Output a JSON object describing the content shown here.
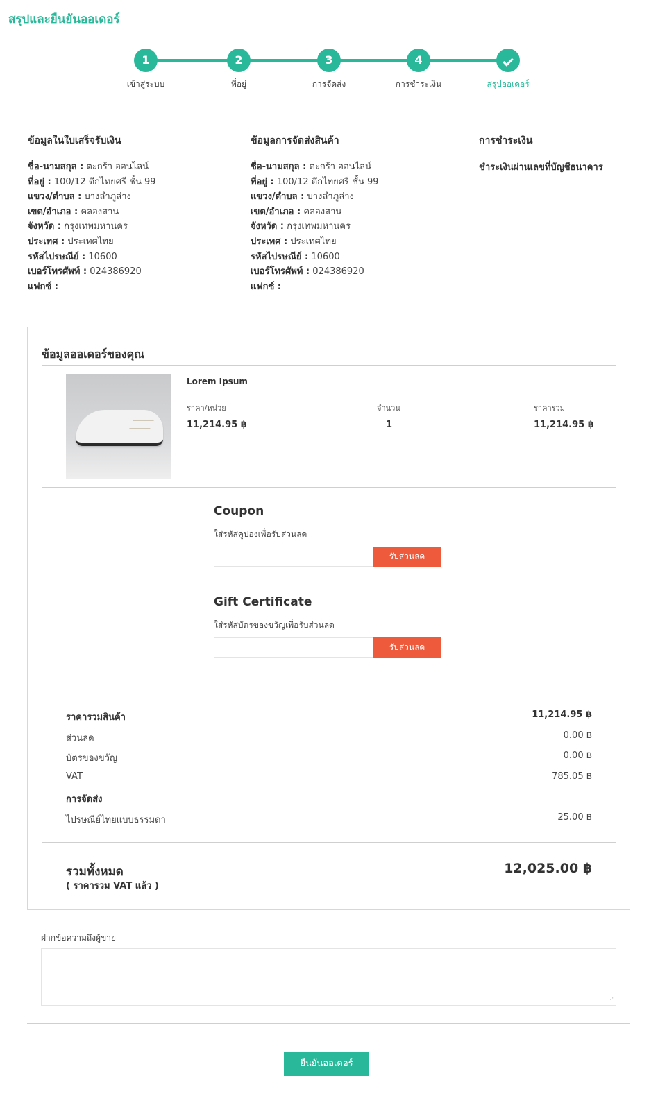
{
  "page_title": "สรุปและยืนยันออเดอร์",
  "colors": {
    "accent": "#2ab89a",
    "button_red": "#ee5a3c"
  },
  "steps": [
    {
      "number": "1",
      "label": "เข้าสู่ระบบ"
    },
    {
      "number": "2",
      "label": "ที่อยู่"
    },
    {
      "number": "3",
      "label": "การจัดส่ง"
    },
    {
      "number": "4",
      "label": "การชำระเงิน"
    },
    {
      "number": "",
      "icon": "check-icon",
      "label": "สรุปออเดอร์"
    }
  ],
  "billing": {
    "title": "ข้อมูลในใบเสร็จรับเงิน",
    "rows": [
      {
        "label": "ชื่อ-นามสกุล :",
        "value": "ตะกร้า ออนไลน์"
      },
      {
        "label": "ที่อยู่ :",
        "value": "100/12 ตึกไทยศรี ชั้น 99"
      },
      {
        "label": "แขวง/ตำบล :",
        "value": "บางลำภูล่าง"
      },
      {
        "label": "เขต/อำเภอ :",
        "value": "คลองสาน"
      },
      {
        "label": "จังหวัด :",
        "value": "กรุงเทพมหานคร"
      },
      {
        "label": "ประเทศ :",
        "value": "ประเทศไทย"
      },
      {
        "label": "รหัสไปรษณีย์ :",
        "value": "10600"
      },
      {
        "label": "เบอร์โทรศัพท์ :",
        "value": "024386920"
      },
      {
        "label": "แฟกซ์ :",
        "value": ""
      }
    ]
  },
  "shipping": {
    "title": "ข้อมูลการจัดส่งสินค้า",
    "rows": [
      {
        "label": "ชื่อ-นามสกุล :",
        "value": "ตะกร้า ออนไลน์"
      },
      {
        "label": "ที่อยู่ :",
        "value": "100/12 ตึกไทยศรี ชั้น 99"
      },
      {
        "label": "แขวง/ตำบล :",
        "value": "บางลำภูล่าง"
      },
      {
        "label": "เขต/อำเภอ :",
        "value": "คลองสาน"
      },
      {
        "label": "จังหวัด :",
        "value": "กรุงเทพมหานคร"
      },
      {
        "label": "ประเทศ :",
        "value": "ประเทศไทย"
      },
      {
        "label": "รหัสไปรษณีย์ :",
        "value": "10600"
      },
      {
        "label": "เบอร์โทรศัพท์ :",
        "value": "024386920"
      },
      {
        "label": "แฟกซ์ :",
        "value": ""
      }
    ]
  },
  "payment": {
    "title": "การชำระเงิน",
    "method": "ชำระเงินผ่านเลขที่บัญชีธนาคาร"
  },
  "order": {
    "title": "ข้อมูลออเดอร์ของคุณ",
    "product": {
      "name": "Lorem Ipsum",
      "unit_price_label": "ราคา/หน่วย",
      "unit_price": "11,214.95 ฿",
      "qty_label": "จำนวน",
      "qty": "1",
      "total_label": "ราคารวม",
      "total": "11,214.95 ฿"
    },
    "coupon": {
      "title": "Coupon",
      "hint": "ใส่รหัสคูปองเพื่อรับส่วนลด",
      "value": "",
      "button": "รับส่วนลด"
    },
    "gift": {
      "title": "Gift Certificate",
      "hint": "ใส่รหัสบัตรของขวัญเพื่อรับส่วนลด",
      "value": "",
      "button": "รับส่วนลด"
    },
    "summary": {
      "subtotal_label": "ราคารวมสินค้า",
      "subtotal": "11,214.95 ฿",
      "discount_label": "ส่วนลด",
      "discount": "0.00 ฿",
      "gift_label": "บัตรของขวัญ",
      "gift": "0.00 ฿",
      "vat_label": "VAT",
      "vat": "785.05 ฿",
      "shipping_label": "การจัดส่ง",
      "shipping_method": "ไปรษณีย์ไทยแบบธรรมดา",
      "shipping_cost": "25.00 ฿"
    },
    "grand_total_label": "รวมทั้งหมด",
    "grand_total_sub": "( ราคารวม VAT แล้ว )",
    "grand_total": "12,025.00 ฿"
  },
  "note": {
    "label": "ฝากข้อความถึงผู้ขาย",
    "value": ""
  },
  "confirm_button": "ยืนยันออเดอร์"
}
